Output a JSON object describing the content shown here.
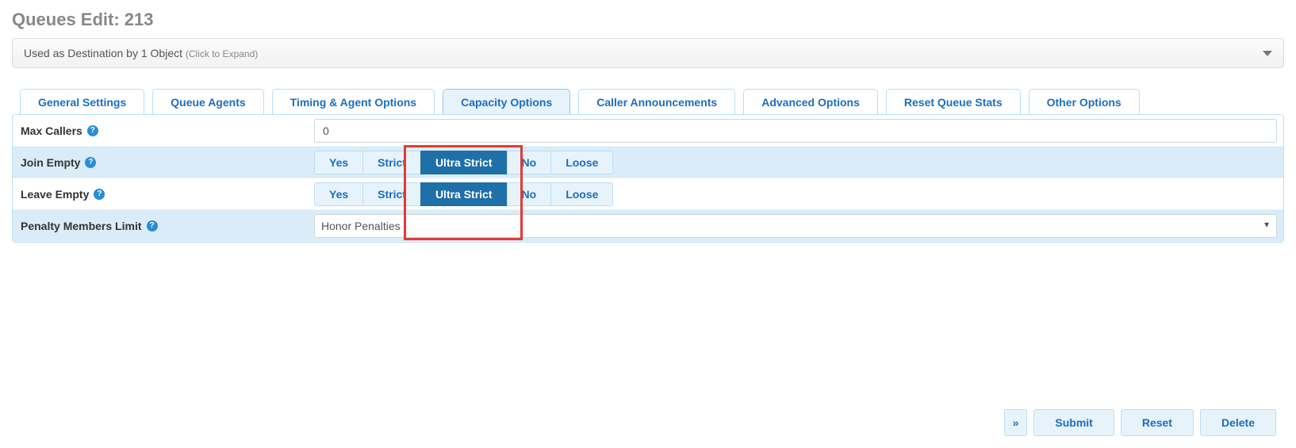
{
  "page_title": "Queues Edit: 213",
  "expand_bar": {
    "text": "Used as Destination by 1 Object",
    "hint": "(Click to Expand)"
  },
  "tabs": [
    "General Settings",
    "Queue Agents",
    "Timing & Agent Options",
    "Capacity Options",
    "Caller Announcements",
    "Advanced Options",
    "Reset Queue Stats",
    "Other Options"
  ],
  "active_tab_index": 3,
  "rows": {
    "max_callers": {
      "label": "Max Callers",
      "value": "0"
    },
    "join_empty": {
      "label": "Join Empty",
      "options": [
        "Yes",
        "Strict",
        "Ultra Strict",
        "No",
        "Loose"
      ],
      "active": 2
    },
    "leave_empty": {
      "label": "Leave Empty",
      "options": [
        "Yes",
        "Strict",
        "Ultra Strict",
        "No",
        "Loose"
      ],
      "active": 2
    },
    "penalty": {
      "label": "Penalty Members Limit",
      "value": "Honor Penalties"
    }
  },
  "footer": {
    "expand_glyph": "»",
    "submit": "Submit",
    "reset": "Reset",
    "delete": "Delete"
  }
}
